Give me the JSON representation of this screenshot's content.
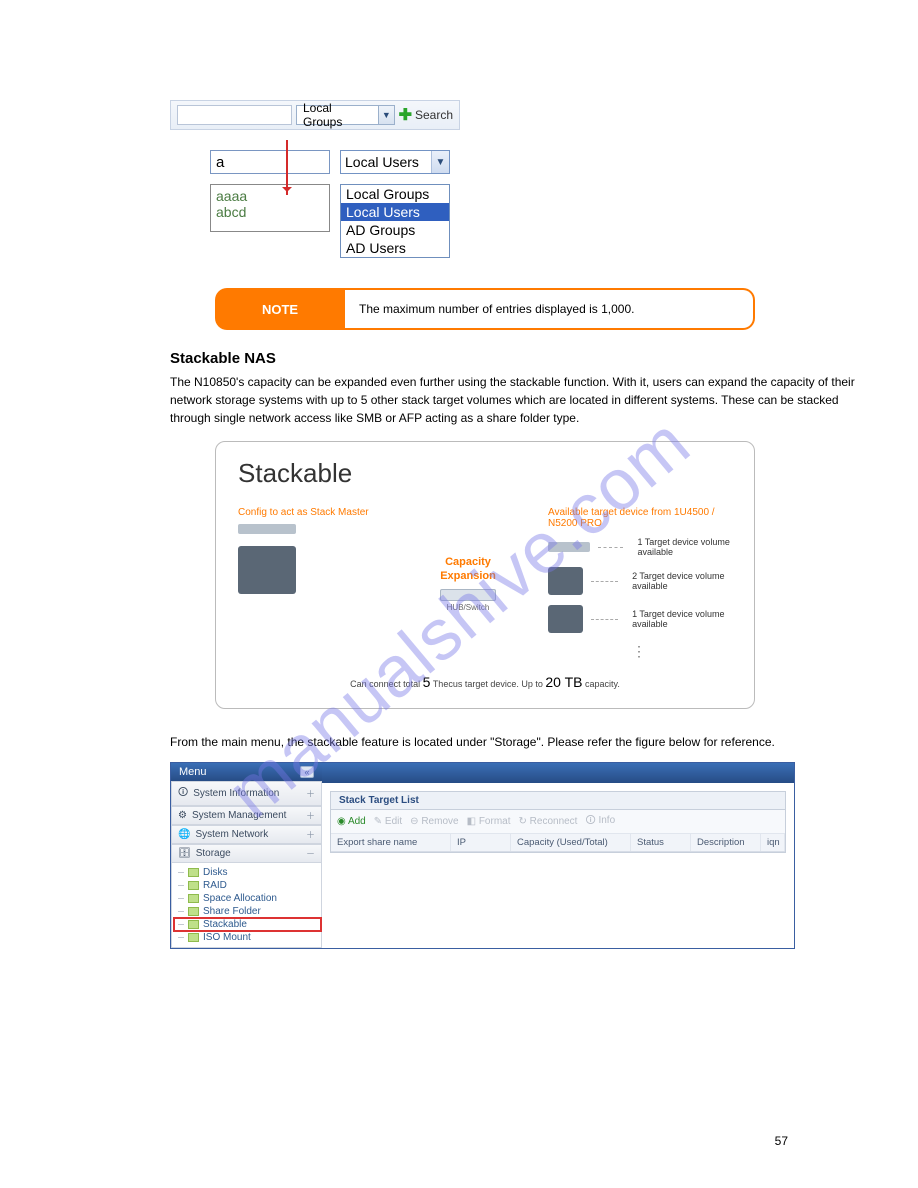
{
  "watermark": "manualshive.com",
  "page_number": "57",
  "search_bar": {
    "select_label": "Local Groups",
    "button": "Search"
  },
  "dropdown_detail": {
    "input_value": "a",
    "select_label": "Local Users",
    "options": [
      "Local Groups",
      "Local Users",
      "AD Groups",
      "AD Users"
    ],
    "results": [
      "aaaa",
      "abcd"
    ]
  },
  "note": {
    "label": "NOTE",
    "text": "The maximum number of entries displayed is 1,000."
  },
  "heading": "Stackable NAS",
  "intro": "The N10850's capacity can be expanded even further using the stackable function. With it, users can expand the capacity of their network storage systems with up to 5 other stack target volumes which are located in different systems. These can be stacked through single network access like SMB or AFP acting as a share folder type.",
  "stack_fig": {
    "title": "Stackable",
    "left_caption": "Config to act as Stack Master",
    "mid1": "Capacity",
    "mid2": "Expansion",
    "hub_label": "HUB/Switch",
    "right_caption": "Available target device from 1U4500 / N5200 PRO",
    "rows": [
      "1 Target device volume available",
      "2 Target device volume available",
      "1 Target device volume available"
    ],
    "footer_pre": "Can connect total ",
    "footer_5": "5",
    "footer_mid": " Thecus target device.   Up to ",
    "footer_20": "20 TB",
    "footer_post": " capacity."
  },
  "para": "From the main menu, the stackable feature is located under \"Storage\". Please refer the figure below for reference.",
  "admin": {
    "menu_title": "Menu",
    "sections": [
      "System Information",
      "System Management",
      "System Network",
      "Storage"
    ],
    "tree": [
      "Disks",
      "RAID",
      "Space Allocation",
      "Share Folder",
      "Stackable",
      "ISO Mount"
    ],
    "stl_title": "Stack Target List",
    "tools": {
      "add": "Add",
      "edit": "Edit",
      "remove": "Remove",
      "format": "Format",
      "reconnect": "Reconnect",
      "info": "Info"
    },
    "cols": [
      "Export share name",
      "IP",
      "Capacity (Used/Total)",
      "Status",
      "Description",
      "iqn"
    ]
  }
}
